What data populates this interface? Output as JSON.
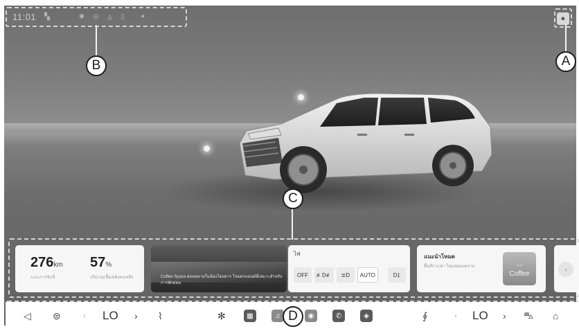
{
  "status_bar": {
    "time": "11:01",
    "icons": [
      "signal-icon",
      "bluetooth-icon",
      "info-icon",
      "notification-icon",
      "device-icon",
      "settings-icon"
    ]
  },
  "profile": {
    "icon": "user-icon"
  },
  "callouts": {
    "a": "A",
    "b": "B",
    "c": "C",
    "d": "D"
  },
  "cards": {
    "stats": {
      "range_value": "276",
      "range_unit": "km",
      "range_label": "ระยะการขับขี่",
      "fuel_value": "57",
      "fuel_unit": "%",
      "fuel_label": "ปริมาณเชื้อเพลิงคงเหลือ"
    },
    "media": {
      "text": "Coffee Space ผ่อนคลายในห้องโดยสาร โหมดรถยนต์ที่เหมาะสำหรับการพักผ่อน"
    },
    "lights": {
      "title": "ไฟ",
      "buttons": [
        "OFF",
        "≢D≢",
        "≣D",
        "AUTO",
        "D‡"
      ]
    },
    "coffee": {
      "title": "แนะนำโหมด",
      "subtitle": "พื้นที่กาแฟ / โหมดผ่อนคลาย",
      "tile_label": "Coffee"
    }
  },
  "dock": {
    "left_temp": "LO",
    "right_temp": "LO",
    "items": [
      "volume-icon",
      "defrost-icon",
      "seat-heat-icon",
      "fan-icon",
      "apps-icon",
      "media-icon",
      "camera-icon",
      "phone-icon",
      "nav-icon",
      "steering-heat-icon",
      "car-icon",
      "home-icon"
    ]
  }
}
